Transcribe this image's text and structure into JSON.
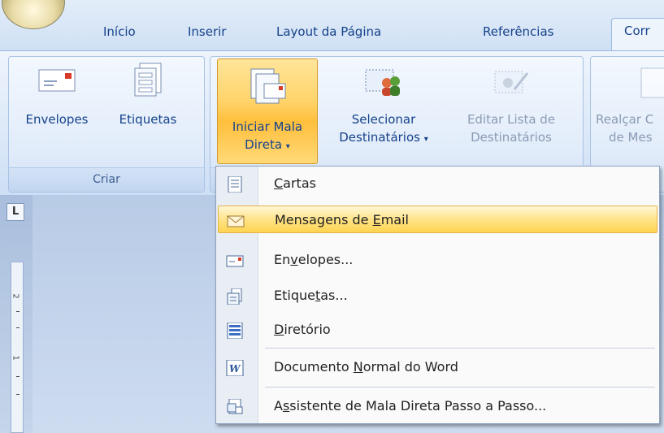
{
  "tabs": [
    {
      "label": "Início"
    },
    {
      "label": "Inserir"
    },
    {
      "label": "Layout da Página"
    },
    {
      "label": "Referências"
    },
    {
      "label": "Corr"
    }
  ],
  "ribbon": {
    "groups": [
      {
        "label": "Criar"
      },
      {
        "label": ""
      }
    ],
    "buttons": {
      "envelopes": "Envelopes",
      "etiquetas": "Etiquetas",
      "iniciar_line1": "Iniciar Mala",
      "iniciar_line2": "Direta",
      "selecionar_line1": "Selecionar",
      "selecionar_line2": "Destinatários",
      "editar_line1": "Editar Lista de",
      "editar_line2": "Destinatários",
      "realcar_line1": "Realçar C",
      "realcar_line2": "de Mes"
    }
  },
  "ruler": {
    "corner": "L",
    "numbers": [
      "2",
      "1"
    ]
  },
  "menu": {
    "items": [
      {
        "pre": "",
        "key": "C",
        "post": "artas",
        "icon": "letter-icon"
      },
      {
        "pre": "Mensagens de ",
        "key": "E",
        "post": "mail",
        "icon": "email-icon",
        "highlighted": true
      },
      {
        "pre": "En",
        "key": "v",
        "post": "elopes...",
        "icon": "envelope-icon"
      },
      {
        "pre": "Etique",
        "key": "t",
        "post": "as...",
        "icon": "labels-icon"
      },
      {
        "pre": "",
        "key": "D",
        "post": "iretório",
        "icon": "directory-icon"
      },
      {
        "pre": "Documento ",
        "key": "N",
        "post": "ormal do Word",
        "icon": "word-document-icon"
      },
      {
        "pre": "A",
        "key": "s",
        "post": "sistente de Mala Direta Passo a Passo...",
        "icon": "wizard-icon"
      }
    ]
  },
  "colors": {
    "accent": "#15428b",
    "highlight": "#ffd34f"
  }
}
